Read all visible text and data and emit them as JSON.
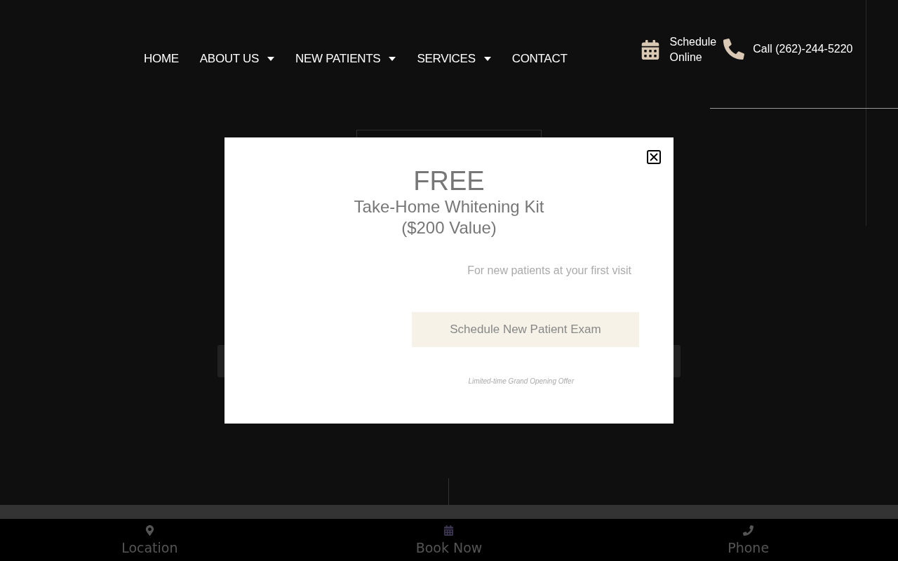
{
  "nav": [
    {
      "label": "HOME",
      "has_menu": false
    },
    {
      "label": "ABOUT US",
      "has_menu": true
    },
    {
      "label": "NEW PATIENTS",
      "has_menu": true
    },
    {
      "label": "SERVICES",
      "has_menu": true
    },
    {
      "label": "CONTACT",
      "has_menu": false
    }
  ],
  "header_actions": {
    "schedule": [
      "Schedule",
      "Online"
    ],
    "call": "Call (262)-244-5220"
  },
  "popup": {
    "headline": "FREE",
    "offer_lines": [
      "Take-Home Whitening Kit",
      "($200 Value)"
    ],
    "note": "For new patients at your first visit",
    "button": "Schedule New Patient Exam",
    "fine_print": "Limited-time Grand Opening Offer"
  },
  "bottom_bar": [
    {
      "kind": "location",
      "label": "Location"
    },
    {
      "kind": "calendar",
      "label": "Book Now"
    },
    {
      "kind": "phone",
      "label": "Phone"
    }
  ]
}
